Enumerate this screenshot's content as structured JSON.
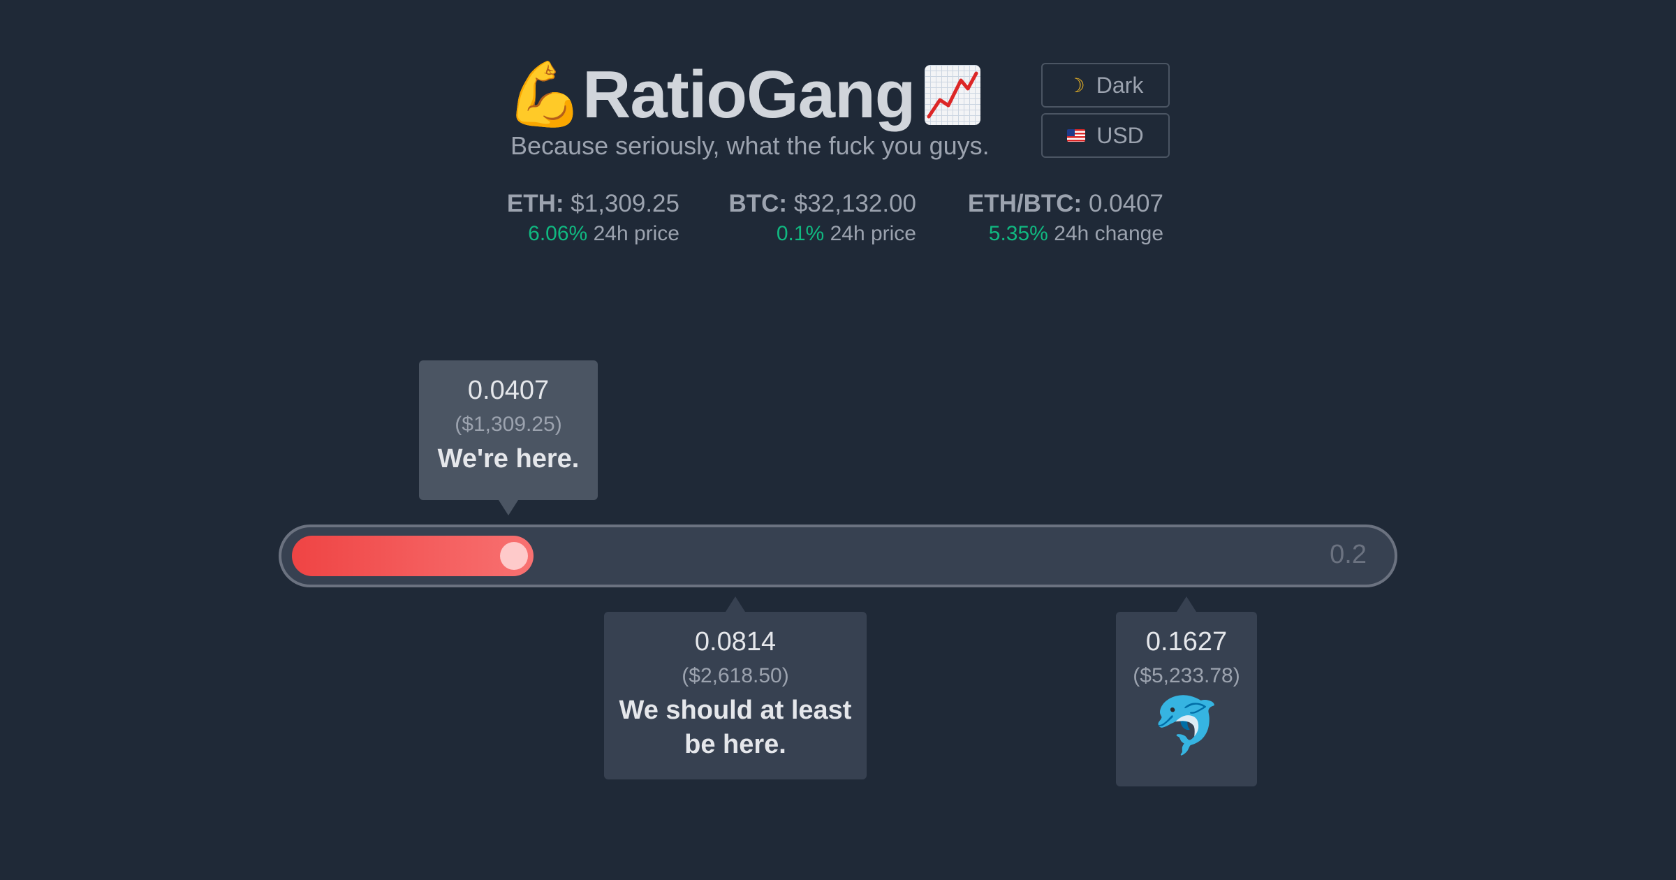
{
  "header": {
    "left_emoji": "💪",
    "title": "RatioGang",
    "right_icon": "chart-increasing-icon",
    "subtitle": "Because seriously, what the fuck you guys."
  },
  "controls": {
    "theme_icon": "moon-icon",
    "theme_label": "Dark",
    "currency_icon": "us-flag-icon",
    "currency_label": "USD"
  },
  "stats": {
    "eth": {
      "label": "ETH:",
      "value": "$1,309.25",
      "change": "6.06%",
      "change_label": "24h price"
    },
    "btc": {
      "label": "BTC:",
      "value": "$32,132.00",
      "change": "0.1%",
      "change_label": "24h price"
    },
    "ratio": {
      "label": "ETH/BTC:",
      "value": "0.0407",
      "change": "5.35%",
      "change_label": "24h change"
    }
  },
  "bar": {
    "current": 0.0407,
    "max": 0.2,
    "max_label": "0.2"
  },
  "markers": {
    "current": {
      "value": "0.0407",
      "usd": "($1,309.25)",
      "caption": "We're here."
    },
    "target": {
      "value": "0.0814",
      "usd": "($2,618.50)",
      "caption": "We should at least be here."
    },
    "flippening": {
      "value": "0.1627",
      "usd": "($5,233.78)",
      "emoji": "🐬"
    }
  },
  "colors": {
    "background": "#1f2937",
    "positive": "#10b981",
    "bar_fill": "#ef4444"
  }
}
